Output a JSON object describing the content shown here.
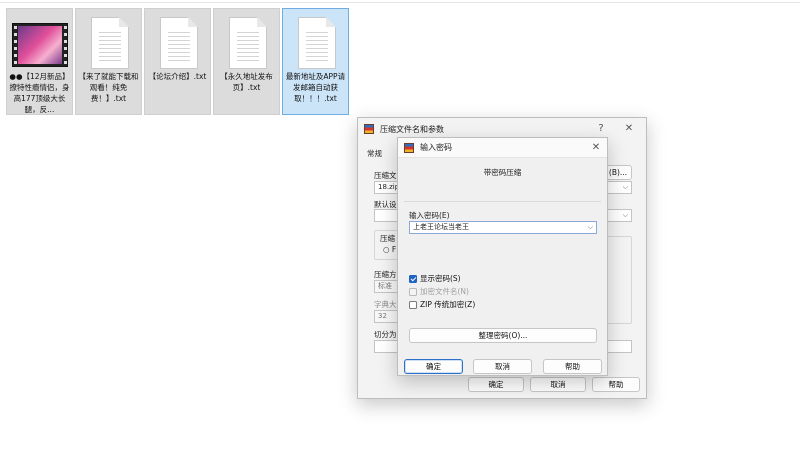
{
  "desktop": {
    "files": [
      {
        "name": "●●【12月新品】撩特性瘾情侣，身高177顶级大长腿，反...",
        "type": "video"
      },
      {
        "name": "【来了就能下载和观看！纯免费！】.txt",
        "type": "txt"
      },
      {
        "name": "【论坛介绍】.txt",
        "type": "txt"
      },
      {
        "name": "【永久地址发布页】.txt",
        "type": "txt"
      },
      {
        "name": "最新地址及APP请发邮箱自动获取！！！.txt",
        "type": "txt",
        "selected": true
      }
    ]
  },
  "archive_dialog": {
    "title": "压缩文件名和参数",
    "help_glyph": "?",
    "close_glyph": "✕",
    "tab_general": "常规",
    "archive_name_label": "压缩文",
    "archive_name_value": "18.zip",
    "browse_label": "(B)...",
    "default_profile_label": "默认设",
    "compress_format_label": "压缩",
    "radio_hint": "○ F",
    "method_label": "压缩方",
    "method_value": "标准",
    "dict_label": "字典大",
    "dict_value": "32",
    "split_label": "切分为",
    "ok_label": "确定",
    "cancel_label": "取消",
    "help_label": "帮助"
  },
  "password_dialog": {
    "title": "输入密码",
    "close_glyph": "✕",
    "header": "带密码压缩",
    "password_label": "输入密码(E)",
    "password_value": "上老王论坛当老王",
    "show_password_label": "显示密码(S)",
    "show_password_checked": true,
    "encrypt_names_label": "加密文件名(N)",
    "encrypt_names_checked": false,
    "zip_legacy_label": "ZIP 传统加密(Z)",
    "zip_legacy_checked": false,
    "organize_label": "整理密码(O)...",
    "ok_label": "确定",
    "cancel_label": "取消",
    "help_label": "帮助"
  }
}
